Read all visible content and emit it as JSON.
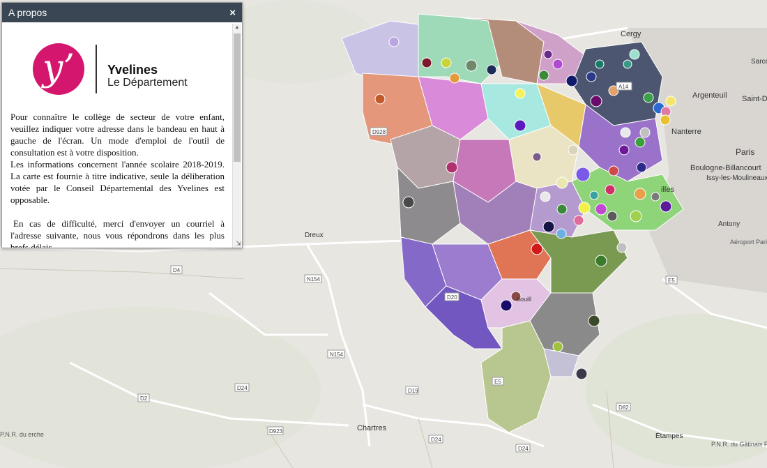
{
  "panel": {
    "title": "A propos",
    "close_symbol": "×",
    "logo": {
      "name": "Yvelines",
      "subtitle": "Le Département"
    },
    "paragraphs": [
      "Pour connaître le collège de secteur de votre enfant, veuillez indiquer votre adresse dans le bandeau en haut à gauche de l'écran. Un mode d'emploi de l'outil de consultation est à votre disposition.",
      "Les informations concernent l'année scolaire 2018-2019. La carte est fournie à titre indicative, seule la déliberation votée par le Conseil Départemental des Yvelines est opposable.",
      "En cas de difficulté, merci d'envoyer un courriel à l'adresse suivante, nous vous répondrons dans les plus brefs délais."
    ]
  },
  "map": {
    "cities": {
      "cergy": "Cergy",
      "argenteuil": "Argenteuil",
      "saint_denis": "Saint-De",
      "sarce": "Sarce",
      "nanterre": "Nanterre",
      "paris": "Paris",
      "boulogne": "Boulogne-Billancourt",
      "issy": "Issy-les-Moulineaux",
      "versailles": "illes",
      "antony": "Antony",
      "orly": "Aéroport Paris-Orly",
      "dreux": "Dreux",
      "chartres": "Chartres",
      "etampes": "Étampes",
      "rambouillet": "bouill",
      "park_gatinais": "P.N.R. du Gâtinais Français",
      "park_perche": "P.N.R. du erche"
    },
    "roads": [
      "D928",
      "D4",
      "N154",
      "N154",
      "D24",
      "D2",
      "D19",
      "D923",
      "D24",
      "D24",
      "D82",
      "E5",
      "D20",
      "E5",
      "A14"
    ]
  },
  "colors": {
    "header": "#3b4655",
    "brand": "#d4166e"
  }
}
